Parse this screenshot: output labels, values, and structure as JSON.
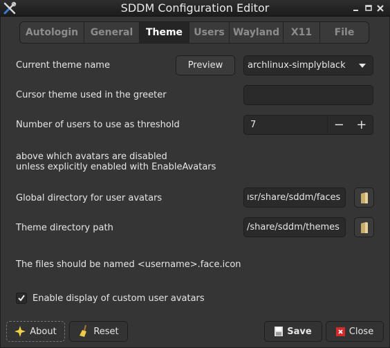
{
  "window": {
    "title": "SDDM Configuration Editor",
    "icon": "tools-icon",
    "controls": [
      "minimize-icon",
      "maximize-icon",
      "close-icon"
    ]
  },
  "tabs": [
    {
      "label": "Autologin",
      "active": false
    },
    {
      "label": "General",
      "active": false
    },
    {
      "label": "Theme",
      "active": true
    },
    {
      "label": "Users",
      "active": false
    },
    {
      "label": "Wayland",
      "active": false
    },
    {
      "label": "X11",
      "active": false
    },
    {
      "label": "File",
      "active": false
    }
  ],
  "theme": {
    "current_theme_label": "Current theme name",
    "preview_button": "Preview",
    "current_theme_value": "archlinux-simplyblack",
    "cursor_theme_label": "Cursor theme used in the greeter",
    "cursor_theme_value": "",
    "threshold_label": "Number of users to use as threshold",
    "threshold_value": "7",
    "spin_minus": "−",
    "spin_plus": "+",
    "threshold_note_line1": "above which avatars are disabled",
    "threshold_note_line2": "unless explicitly enabled with EnableAvatars",
    "avatar_dir_label": "Global directory for user avatars",
    "avatar_dir_value": "ısr/share/sddm/faces",
    "theme_dir_label": "Theme directory path",
    "theme_dir_value": "/share/sddm/themes",
    "files_note": "The files should be named <username>.face.icon",
    "enable_avatars_label": "Enable display of custom user avatars",
    "enable_avatars_checked": true
  },
  "footer": {
    "about": "About",
    "reset": "Reset",
    "save": "Save",
    "close": "Close"
  }
}
